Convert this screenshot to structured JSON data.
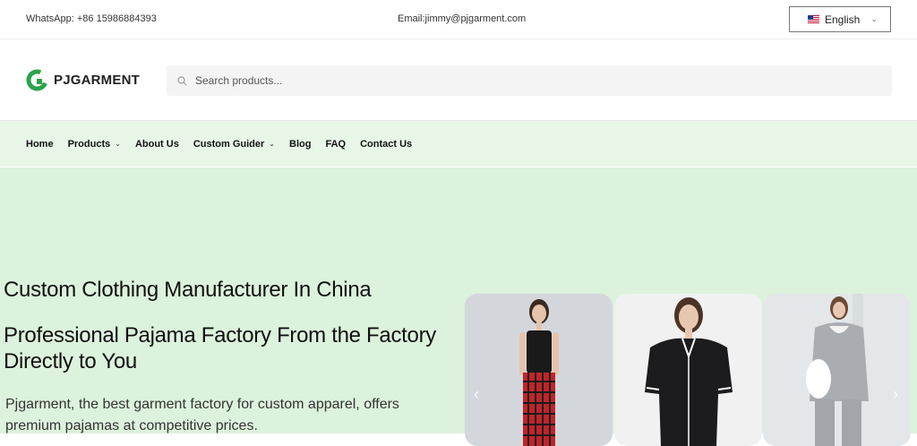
{
  "topbar": {
    "whatsapp": "WhatsApp: +86 15986884393",
    "email": "Email:jimmy@pjgarment.com",
    "language": "English",
    "flag_icon": "us-flag-icon"
  },
  "header": {
    "logo_text": "PJGARMENT",
    "search_placeholder": "Search products..."
  },
  "nav": {
    "items": [
      {
        "label": "Home",
        "dropdown": false
      },
      {
        "label": "Products",
        "dropdown": true
      },
      {
        "label": "About Us",
        "dropdown": false
      },
      {
        "label": "Custom Guider",
        "dropdown": true
      },
      {
        "label": "Blog",
        "dropdown": false
      },
      {
        "label": "FAQ",
        "dropdown": false
      },
      {
        "label": "Contact Us",
        "dropdown": false
      }
    ]
  },
  "hero": {
    "title": "Custom Clothing Manufacturer In China",
    "subtitle": "Professional Pajama Factory From the Factory Directly to You",
    "description": "Pjgarment, the best garment factory for custom apparel, offers premium pajamas at competitive prices."
  },
  "colors": {
    "brand_green": "#2aa34a",
    "nav_bg": "#e7f6e7",
    "hero_bg": "#dcf2dc"
  },
  "icons": {
    "search": "search-icon",
    "prev": "chevron-left-icon",
    "next": "chevron-right-icon",
    "dropdown": "chevron-down-icon"
  }
}
